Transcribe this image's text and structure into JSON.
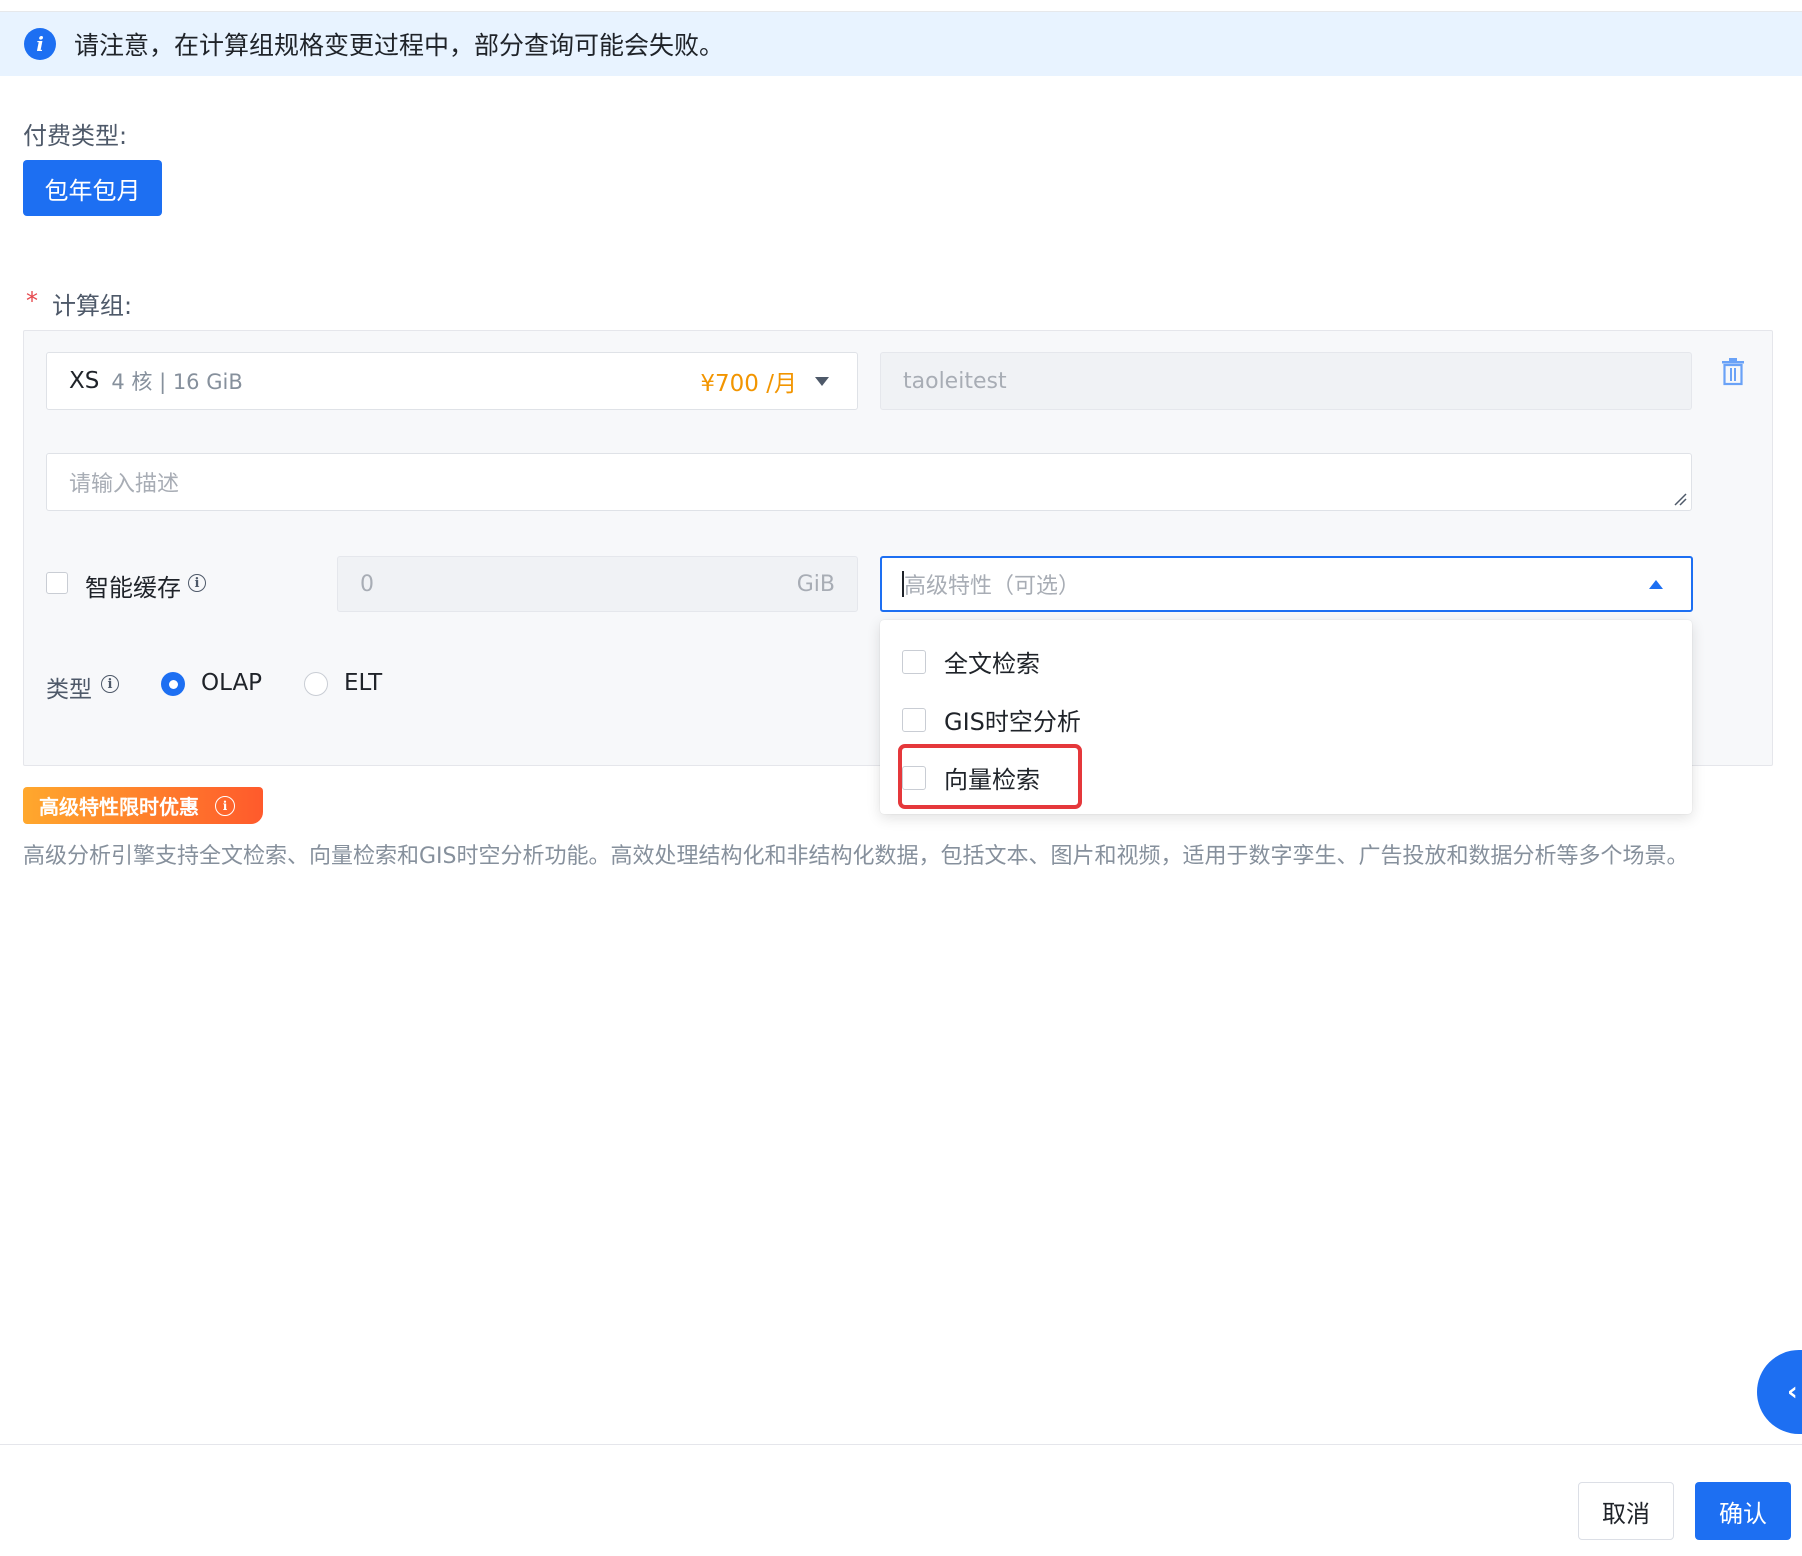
{
  "notice": {
    "icon": "info-icon",
    "text": "请注意，在计算组规格变更过程中，部分查询可能会失败。"
  },
  "billing": {
    "label": "付费类型:",
    "option": "包年包月"
  },
  "compute_group": {
    "required_mark": "*",
    "label": "计算组:",
    "size": "XS",
    "spec": "4 核 | 16 GiB",
    "price": "¥700 /月",
    "name_value": "taoleitest",
    "description_placeholder": "请输入描述",
    "smart_cache": {
      "label": "智能缓存",
      "checked": false,
      "value": "0",
      "unit": "GiB"
    },
    "advanced_features": {
      "placeholder": "高级特性（可选）",
      "expanded": true,
      "options": [
        {
          "label": "全文检索",
          "checked": false
        },
        {
          "label": "GIS时空分析",
          "checked": false
        },
        {
          "label": "向量检索",
          "checked": false,
          "highlighted": true
        }
      ]
    },
    "type": {
      "label": "类型",
      "options": [
        {
          "label": "OLAP",
          "selected": true
        },
        {
          "label": "ELT",
          "selected": false
        }
      ]
    }
  },
  "promo": {
    "tag": "高级特性限时优惠",
    "description": "高级分析引擎支持全文检索、向量检索和GIS时空分析功能。高效处理结构化和非结构化数据，包括文本、图片和视频，适用于数字孪生、广告投放和数据分析等多个场景。"
  },
  "footer": {
    "cancel": "取消",
    "confirm": "确认"
  },
  "float_button": {
    "icon": "chevron-left-icon",
    "glyph": "‹"
  },
  "colors": {
    "primary": "#1d6ff2",
    "price": "#f29500",
    "notice_bg": "#e8f3ff",
    "highlight": "#e5383b"
  }
}
